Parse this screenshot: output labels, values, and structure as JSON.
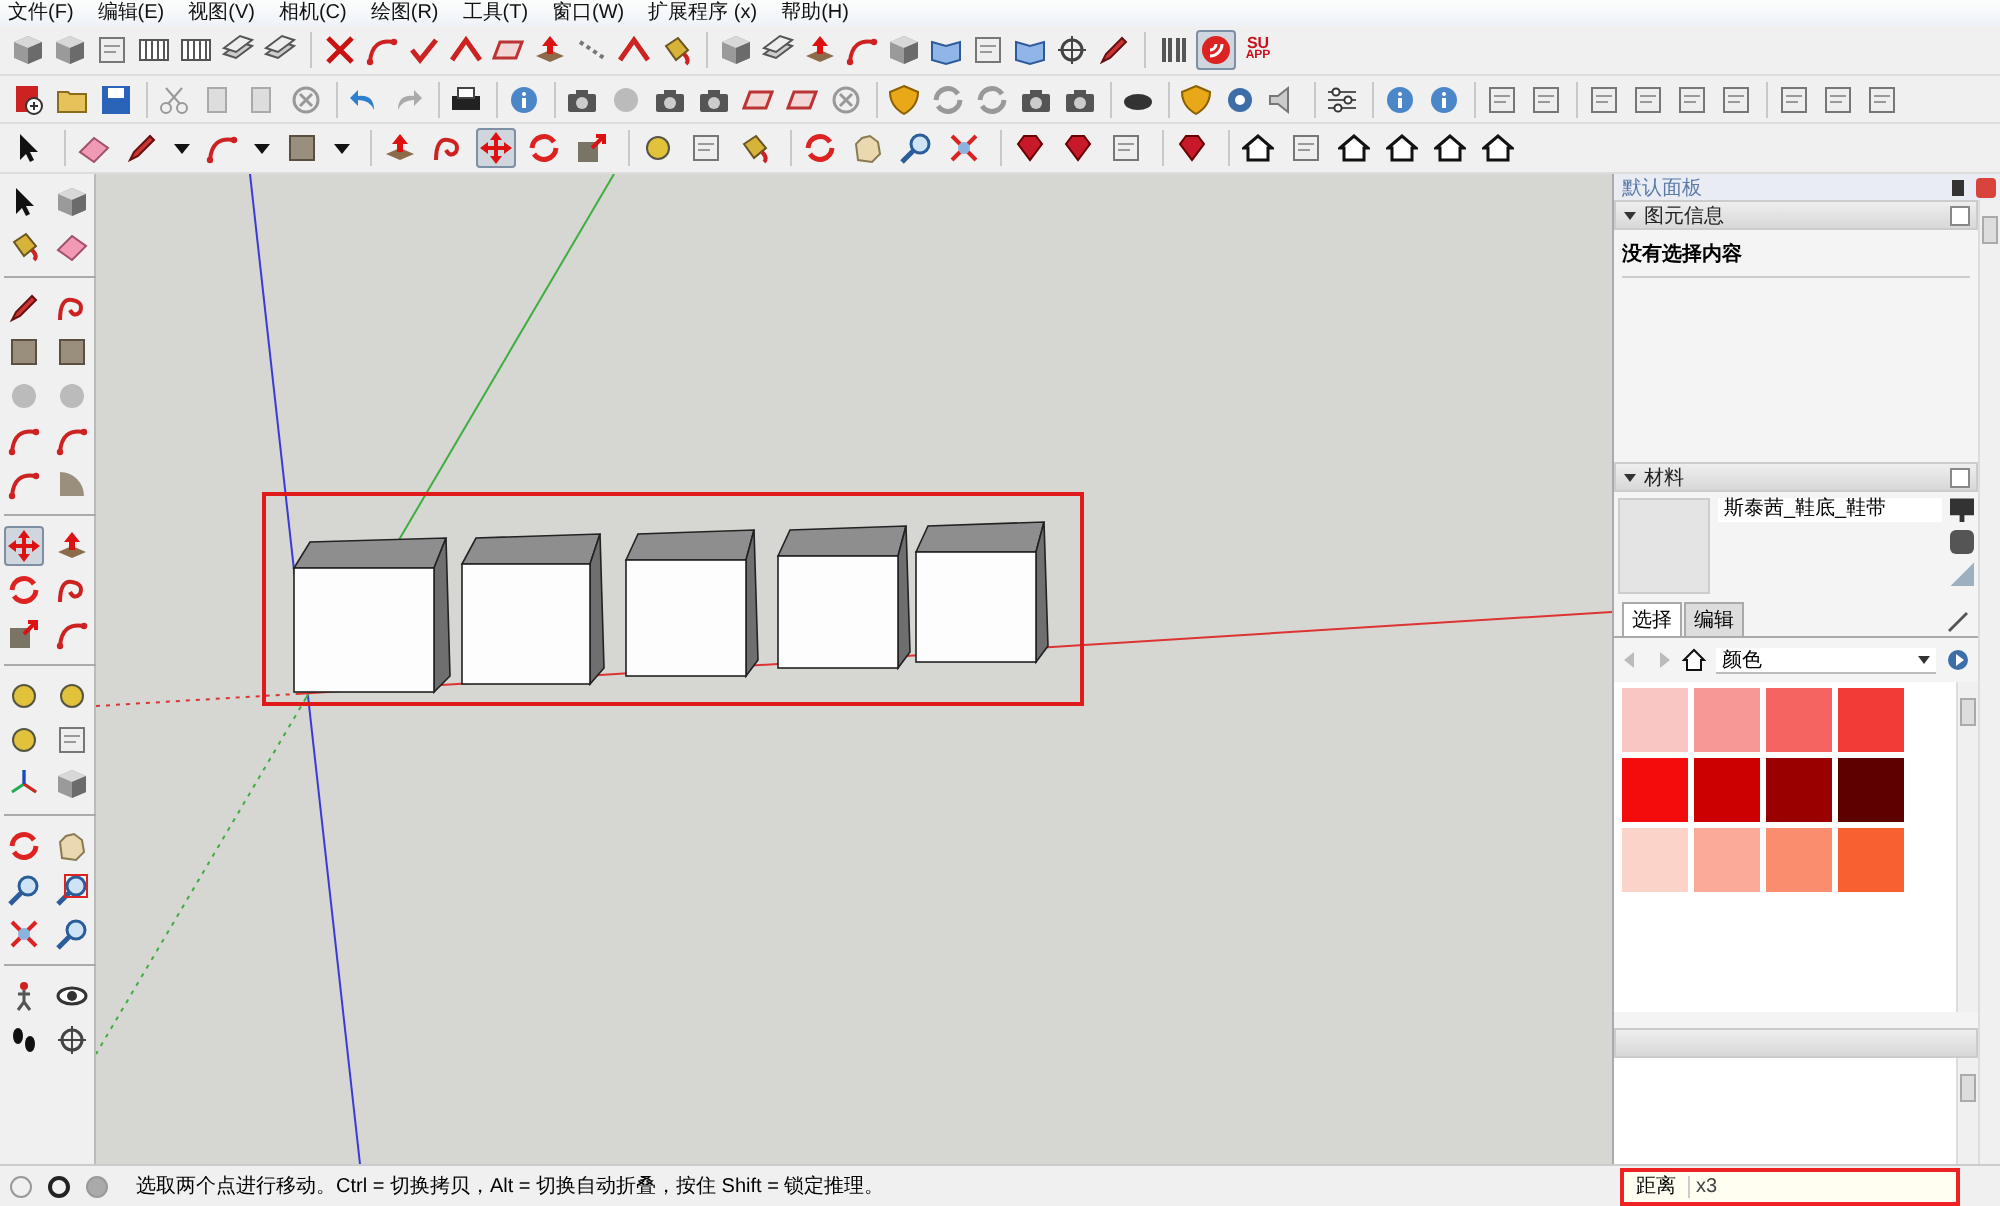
{
  "menu": [
    {
      "label": "文件(F)"
    },
    {
      "label": "编辑(E)"
    },
    {
      "label": "视图(V)"
    },
    {
      "label": "相机(C)"
    },
    {
      "label": "绘图(R)"
    },
    {
      "label": "工具(T)"
    },
    {
      "label": "窗口(W)"
    },
    {
      "label": "扩展程序 (x)"
    },
    {
      "label": "帮助(H)"
    }
  ],
  "toolbars": [
    {
      "tools": [
        {
          "selected": false
        },
        {
          "selected": false
        },
        {
          "selected": false
        },
        {
          "selected": false
        },
        {
          "selected": false
        },
        {
          "selected": false
        },
        {
          "selected": false
        },
        {
          "selected": false
        },
        {
          "selected": false
        },
        {
          "selected": false
        },
        {
          "selected": false
        },
        {
          "selected": false
        },
        {
          "selected": false
        },
        {
          "selected": false
        },
        {
          "selected": false
        },
        {
          "selected": false
        },
        {
          "selected": false
        },
        {
          "selected": false
        },
        {
          "selected": false
        },
        {
          "selected": false
        },
        {
          "selected": false
        },
        {
          "selected": false
        },
        {
          "selected": false
        },
        {
          "selected": false
        },
        {
          "selected": false
        },
        {
          "selected": false
        },
        {
          "selected": false
        },
        {
          "selected": true
        },
        {
          "selected": false
        }
      ]
    },
    {
      "tools": [
        {
          "selected": false
        },
        {
          "selected": false
        },
        {
          "selected": false
        },
        {
          "selected": false
        },
        {
          "selected": false
        },
        {
          "selected": false
        },
        {
          "selected": false
        },
        {
          "selected": false
        },
        {
          "selected": false
        },
        {
          "selected": false
        },
        {
          "selected": false
        },
        {
          "selected": false
        },
        {
          "selected": false
        },
        {
          "selected": false
        },
        {
          "selected": false
        },
        {
          "selected": false
        },
        {
          "selected": false
        },
        {
          "selected": false
        },
        {
          "selected": false
        },
        {
          "selected": false
        },
        {
          "selected": false
        },
        {
          "selected": false
        },
        {
          "selected": false
        },
        {
          "selected": false
        },
        {
          "selected": false
        },
        {
          "selected": false
        },
        {
          "selected": false
        },
        {
          "selected": false
        },
        {
          "selected": false
        },
        {
          "selected": false
        },
        {
          "selected": false
        },
        {
          "selected": false
        },
        {
          "selected": false
        },
        {
          "selected": false
        },
        {
          "selected": false
        },
        {
          "selected": false
        },
        {
          "selected": false
        },
        {
          "selected": false
        },
        {
          "selected": false
        }
      ]
    },
    {
      "tools": [
        {
          "selected": false
        },
        {
          "selected": false
        },
        {
          "selected": false
        },
        {
          "selected": false
        },
        {
          "selected": false
        },
        {
          "selected": false
        },
        {
          "selected": false
        },
        {
          "selected": false
        },
        {
          "selected": false
        },
        {
          "selected": false
        },
        {
          "selected": true
        },
        {
          "selected": false
        },
        {
          "selected": false
        },
        {
          "selected": false
        },
        {
          "selected": false
        },
        {
          "selected": false
        },
        {
          "selected": false
        },
        {
          "selected": false
        },
        {
          "selected": false
        },
        {
          "selected": false
        },
        {
          "selected": false
        },
        {
          "selected": false
        },
        {
          "selected": false
        },
        {
          "selected": false
        },
        {
          "selected": false
        },
        {
          "selected": false
        },
        {
          "selected": false
        },
        {
          "selected": false
        },
        {
          "selected": false
        },
        {
          "selected": false
        }
      ]
    }
  ],
  "su_logo": {
    "line1": "SU",
    "line2": "APP"
  },
  "left_toolbar": {
    "tools": [
      {
        "selected": false
      },
      {
        "selected": false
      },
      {
        "selected": false
      },
      {
        "selected": false
      },
      {
        "selected": false
      },
      {
        "selected": false
      },
      {
        "selected": false
      },
      {
        "selected": false
      },
      {
        "selected": false
      },
      {
        "selected": false
      },
      {
        "selected": false
      },
      {
        "selected": false
      },
      {
        "selected": false
      },
      {
        "selected": false
      },
      {
        "selected": true
      },
      {
        "selected": false
      },
      {
        "selected": false
      },
      {
        "selected": false
      },
      {
        "selected": false
      },
      {
        "selected": false
      },
      {
        "selected": false
      },
      {
        "selected": false
      },
      {
        "selected": false
      },
      {
        "selected": false
      },
      {
        "selected": false
      },
      {
        "selected": false
      },
      {
        "selected": false
      },
      {
        "selected": false
      },
      {
        "selected": false
      },
      {
        "selected": false
      },
      {
        "selected": false
      },
      {
        "selected": false
      },
      {
        "selected": false
      },
      {
        "selected": false
      },
      {
        "selected": false
      },
      {
        "selected": false
      }
    ]
  },
  "tray": {
    "title": "默认面板",
    "entity_info": {
      "title": "图元信息",
      "message": "没有选择内容"
    },
    "materials": {
      "title": "材料",
      "name": "斯泰茜_鞋底_鞋带",
      "tabs": [
        {
          "label": "选择",
          "selected": true
        },
        {
          "label": "编辑",
          "selected": false
        }
      ],
      "library": "颜色",
      "swatches": [
        {
          "color": "#f9c6c4"
        },
        {
          "color": "#f79896"
        },
        {
          "color": "#f66462"
        },
        {
          "color": "#f23a36"
        },
        {
          "color": "#f40b0b"
        },
        {
          "color": "#cc0000"
        },
        {
          "color": "#9b0000"
        },
        {
          "color": "#5f0000"
        },
        {
          "color": "#fcd3c8"
        },
        {
          "color": "#fbaa98"
        },
        {
          "color": "#f98d6e"
        },
        {
          "color": "#f96030"
        }
      ]
    }
  },
  "status_bar": {
    "message": "选取两个点进行移动。Ctrl = 切换拷贝，Alt = 切换自动折叠，按住 Shift = 锁定推理。",
    "measurement_label": "距离",
    "measurement_value": "x3"
  }
}
